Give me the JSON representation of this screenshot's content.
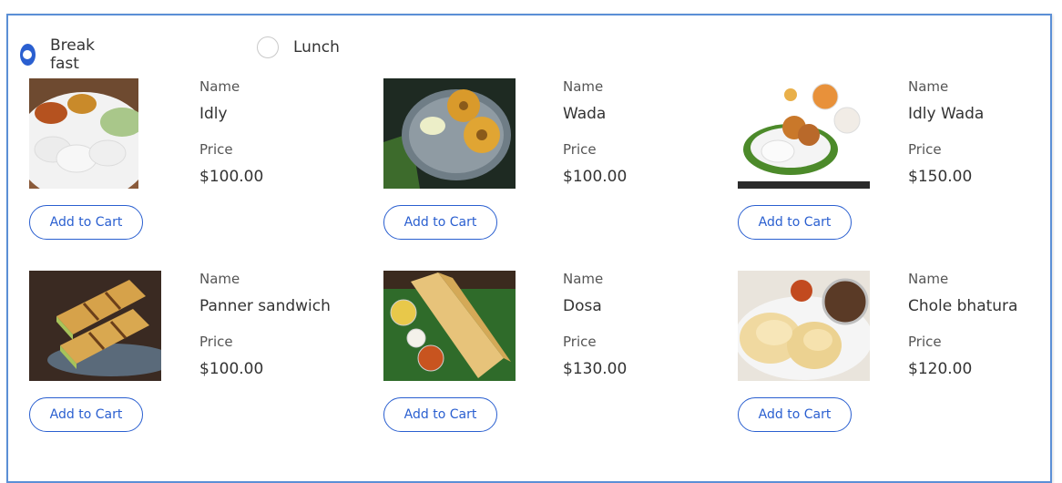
{
  "meal_selector": {
    "options": [
      {
        "label": "Break fast",
        "selected": true
      },
      {
        "label": "Lunch",
        "selected": false
      }
    ]
  },
  "field_labels": {
    "name": "Name",
    "price": "Price"
  },
  "products": [
    {
      "name": "Idly",
      "price": "$100.00",
      "button": "Add to Cart"
    },
    {
      "name": "Wada",
      "price": "$100.00",
      "button": "Add to Cart"
    },
    {
      "name": "Idly Wada",
      "price": "$150.00",
      "button": "Add to Cart"
    },
    {
      "name": "Panner sandwich",
      "price": "$100.00",
      "button": "Add to Cart"
    },
    {
      "name": "Dosa",
      "price": "$130.00",
      "button": "Add to Cart"
    },
    {
      "name": "Chole bhatura",
      "price": "$120.00",
      "button": "Add to Cart"
    }
  ],
  "colors": {
    "accent": "#2a5fd0",
    "panel_border": "#5b8fd6"
  }
}
